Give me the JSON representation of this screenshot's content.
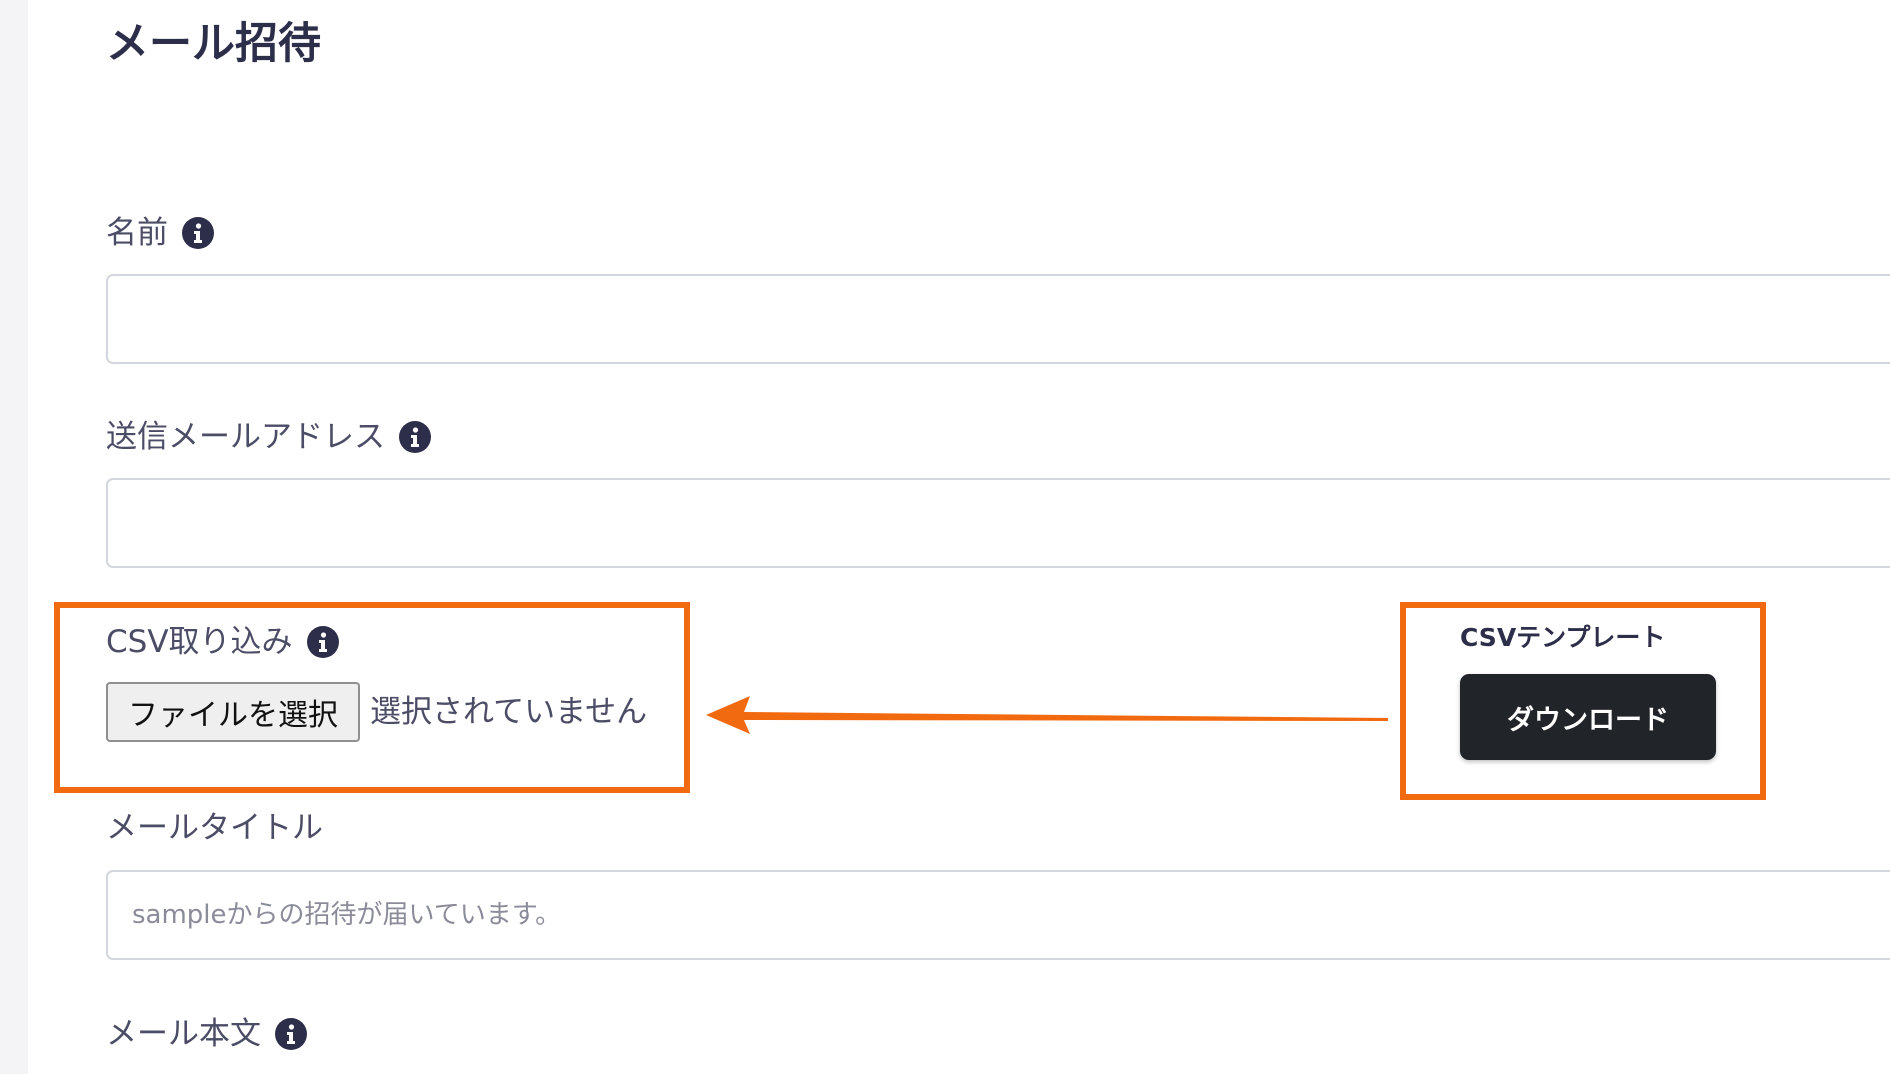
{
  "page": {
    "title": "メール招待"
  },
  "fields": {
    "name": {
      "label": "名前",
      "value": "",
      "placeholder": ""
    },
    "sender_email": {
      "label": "送信メールアドレス",
      "value": "",
      "placeholder": ""
    },
    "csv_import": {
      "label": "CSV取り込み",
      "button_label": "ファイルを選択",
      "status": "選択されていません"
    },
    "mail_title": {
      "label": "メールタイトル",
      "value": "",
      "placeholder": "sampleからの招待が届いています。"
    },
    "mail_body": {
      "label": "メール本文"
    }
  },
  "csv_template": {
    "label": "CSVテンプレート",
    "button_label": "ダウンロード"
  },
  "colors": {
    "highlight": "#f26a10",
    "text_dark": "#2d2e4a",
    "label": "#4b4c66",
    "button_dark": "#212428"
  },
  "icons": {
    "info": "info-circle-icon",
    "annotation": "arrow-left-icon"
  }
}
